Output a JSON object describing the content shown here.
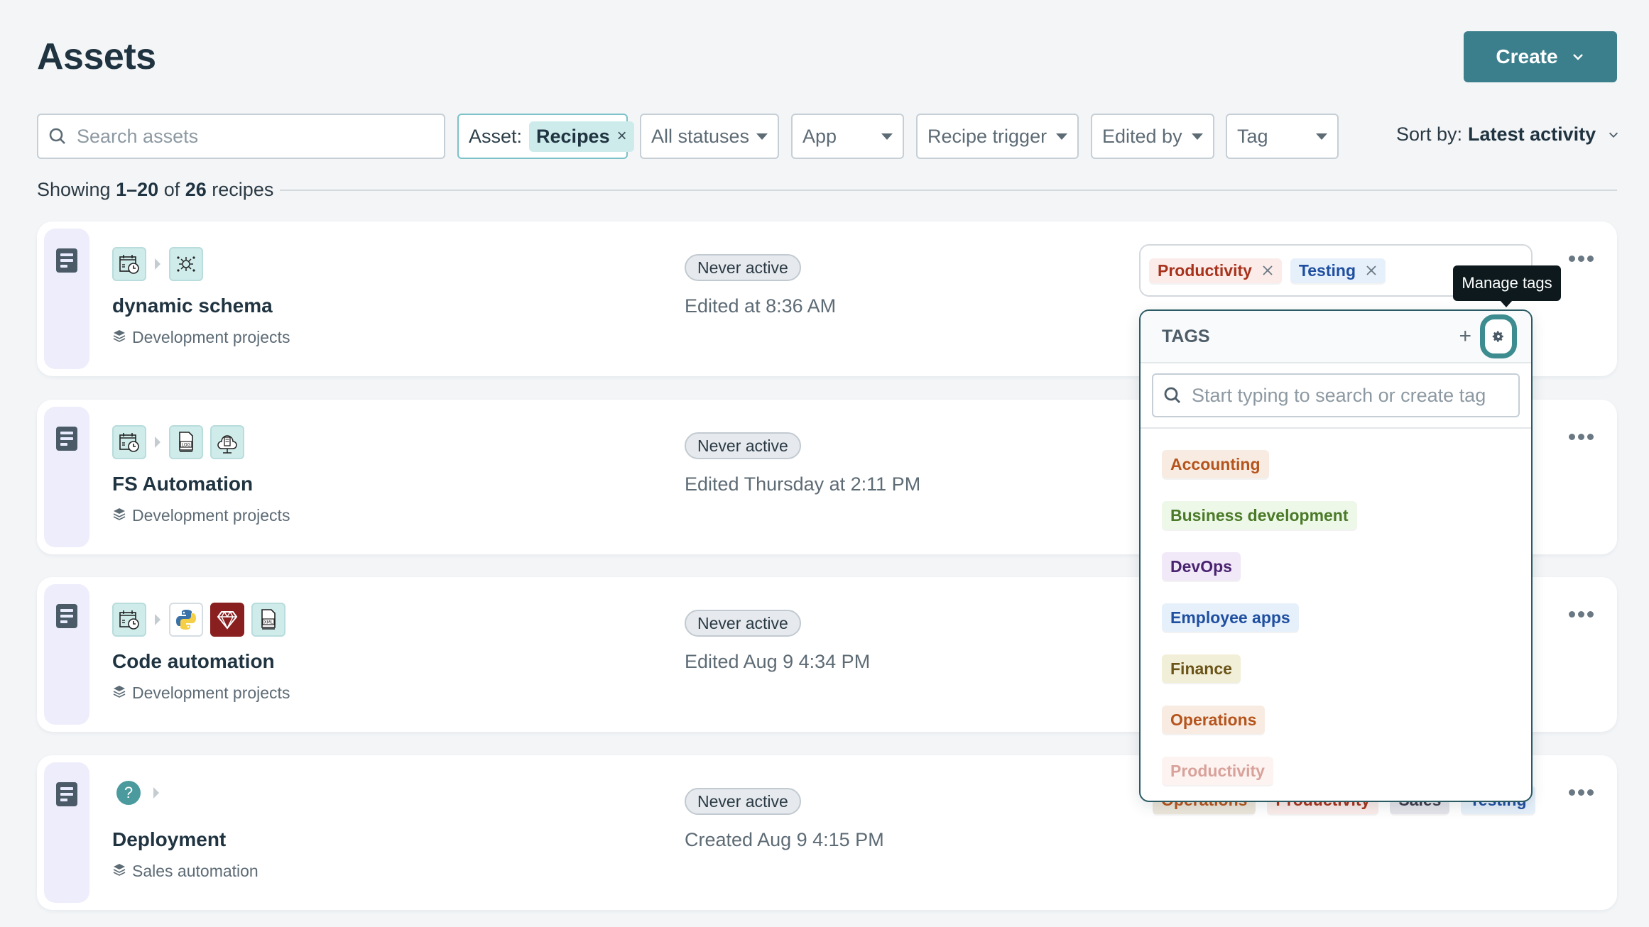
{
  "header": {
    "title": "Assets",
    "create_label": "Create"
  },
  "filters": {
    "search_placeholder": "Search assets",
    "asset_label": "Asset:",
    "asset_value": "Recipes",
    "status": "All statuses",
    "app": "App",
    "trigger": "Recipe trigger",
    "edited_by": "Edited by",
    "tag": "Tag",
    "sort_label": "Sort by:",
    "sort_value": "Latest activity"
  },
  "summary": {
    "prefix": "Showing",
    "range": "1–20",
    "of": "of",
    "total": "26",
    "suffix": "recipes"
  },
  "recipes": [
    {
      "name": "dynamic schema",
      "project": "Development projects",
      "status": "Never active",
      "timestamp": "Edited at 8:36 AM",
      "apps": [
        "scheduler-icon",
        "gear-workflow-icon"
      ],
      "tags": [
        "Productivity",
        "Testing"
      ]
    },
    {
      "name": "FS Automation",
      "project": "Development projects",
      "status": "Never active",
      "timestamp": "Edited Thursday at 2:11 PM",
      "apps": [
        "scheduler-icon",
        "log-file-icon",
        "cloud-file-icon"
      ]
    },
    {
      "name": "Code automation",
      "project": "Development projects",
      "status": "Never active",
      "timestamp": "Edited Aug 9 4:34 PM",
      "apps": [
        "scheduler-icon",
        "python-icon",
        "ruby-icon",
        "xml-file-icon"
      ]
    },
    {
      "name": "Deployment",
      "project": "Sales automation",
      "status": "Never active",
      "timestamp": "Created Aug 9 4:15 PM",
      "apps": [
        "unknown-trigger-icon"
      ],
      "tags": [
        "Operations",
        "Productivity",
        "Sales",
        "Testing"
      ]
    }
  ],
  "tags_dropdown": {
    "title": "TAGS",
    "add_label": "+",
    "search_placeholder": "Start typing to search or create tag",
    "tooltip": "Manage tags",
    "items": [
      {
        "label": "Accounting",
        "color": "#b5541c",
        "bg": "#f8ece2"
      },
      {
        "label": "Business development",
        "color": "#4a7a28",
        "bg": "#eef8e8"
      },
      {
        "label": "DevOps",
        "color": "#4a2470",
        "bg": "#f1e8f8"
      },
      {
        "label": "Employee apps",
        "color": "#1f4fa0",
        "bg": "#e6f0fa"
      },
      {
        "label": "Finance",
        "color": "#6a5418",
        "bg": "#f2efd8"
      },
      {
        "label": "Operations",
        "color": "#b5541c",
        "bg": "#f8ece2"
      },
      {
        "label": "Productivity",
        "color": "#d8a29a",
        "bg": "#fdf3f1"
      }
    ]
  },
  "tag_colors": {
    "Productivity": {
      "color": "#a8321c",
      "bg": "#fbecea"
    },
    "Testing": {
      "color": "#1f4fa0",
      "bg": "#e6f0fa"
    },
    "Operations": {
      "color": "#b5541c",
      "bg": "#ece6da"
    },
    "Sales": {
      "color": "#3c3a4a",
      "bg": "#e4e4ea"
    }
  },
  "accent_color": "#3b7f8c"
}
